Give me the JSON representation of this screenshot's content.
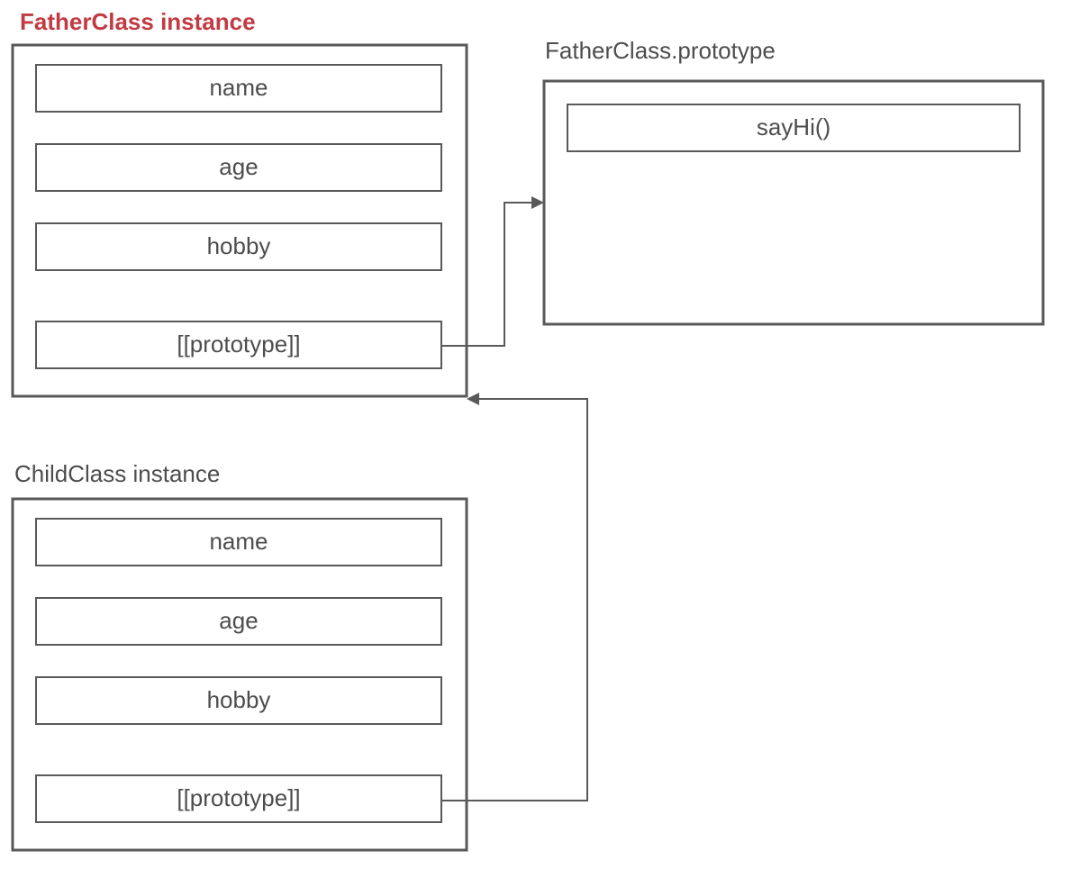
{
  "diagram": {
    "father_instance": {
      "title": "FatherClass instance",
      "title_color": "red",
      "props": [
        "name",
        "age",
        "hobby",
        "[[prototype]]"
      ]
    },
    "father_prototype": {
      "title": "FatherClass.prototype",
      "props": [
        "sayHi()"
      ]
    },
    "child_instance": {
      "title": "ChildClass instance",
      "props": [
        "name",
        "age",
        "hobby",
        "[[prototype]]"
      ]
    },
    "relations": [
      {
        "from": "father_instance.[[prototype]]",
        "to": "father_prototype"
      },
      {
        "from": "child_instance.[[prototype]]",
        "to": "father_instance"
      }
    ]
  }
}
